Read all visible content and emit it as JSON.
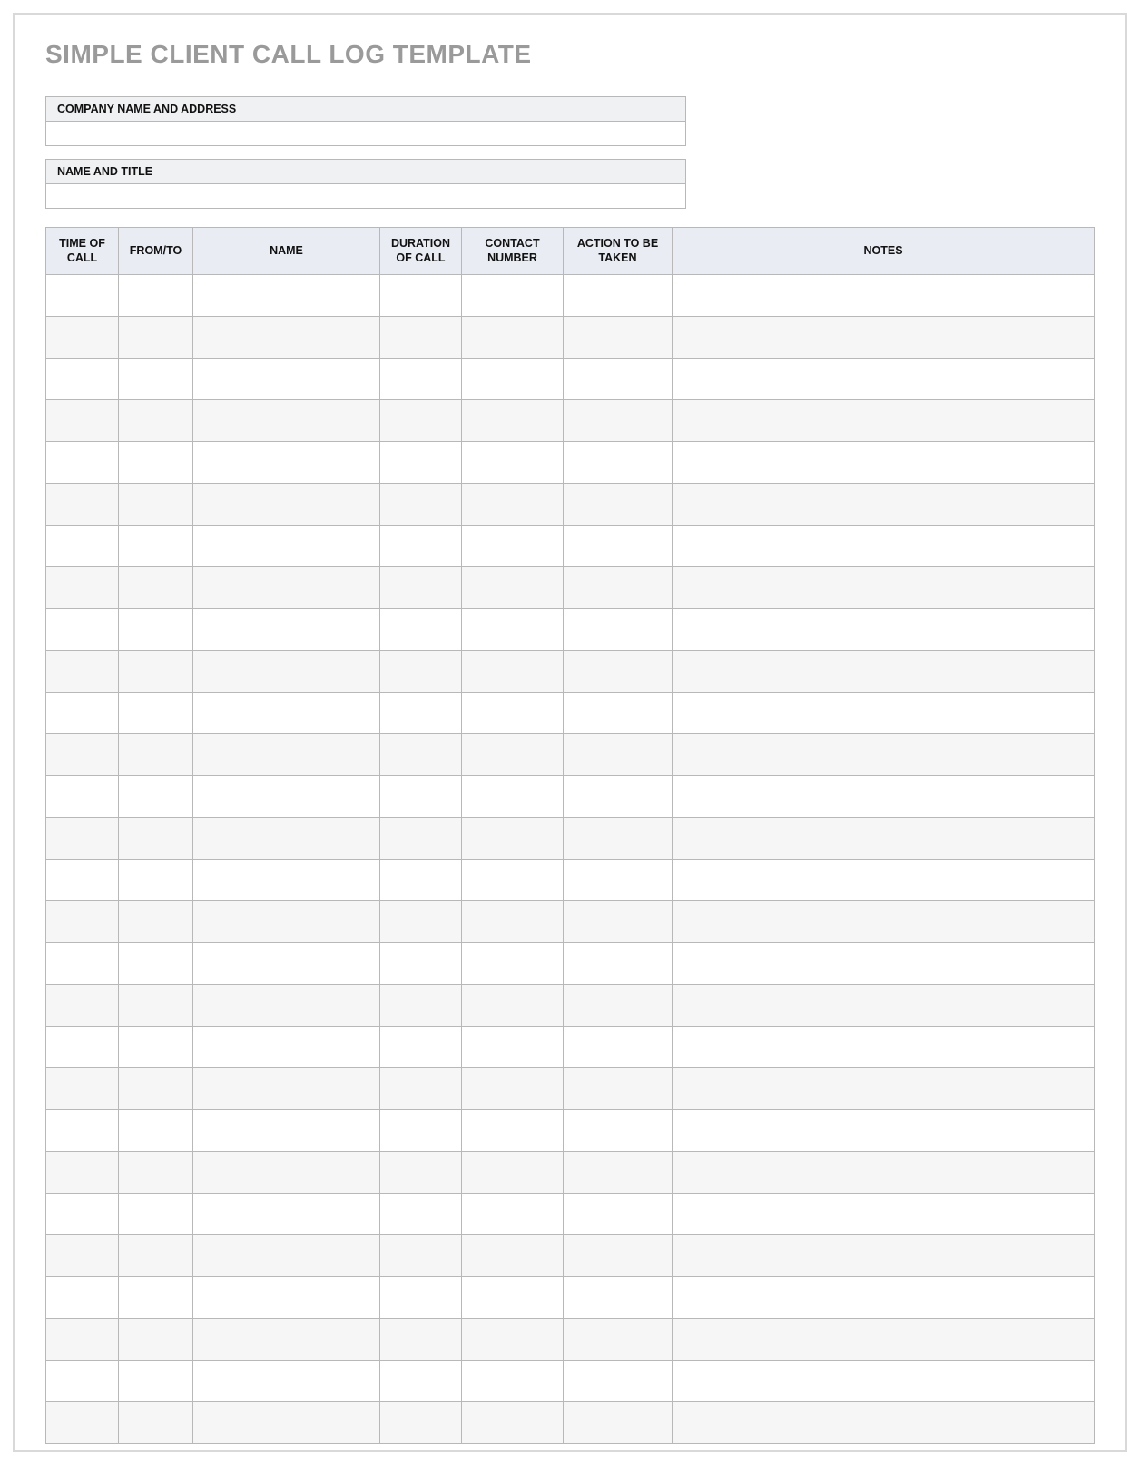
{
  "title": "SIMPLE CLIENT CALL LOG TEMPLATE",
  "info": {
    "company_label": "COMPANY NAME AND ADDRESS",
    "company_value": "",
    "name_label": "NAME AND TITLE",
    "name_value": ""
  },
  "table": {
    "headers": {
      "time": "TIME OF CALL",
      "fromto": "FROM/TO",
      "name": "NAME",
      "duration": "DURATION OF CALL",
      "contact": "CONTACT NUMBER",
      "action": "ACTION TO BE TAKEN",
      "notes": "NOTES"
    },
    "row_count": 28,
    "rows": [
      {
        "time": "",
        "fromto": "",
        "name": "",
        "duration": "",
        "contact": "",
        "action": "",
        "notes": ""
      },
      {
        "time": "",
        "fromto": "",
        "name": "",
        "duration": "",
        "contact": "",
        "action": "",
        "notes": ""
      },
      {
        "time": "",
        "fromto": "",
        "name": "",
        "duration": "",
        "contact": "",
        "action": "",
        "notes": ""
      },
      {
        "time": "",
        "fromto": "",
        "name": "",
        "duration": "",
        "contact": "",
        "action": "",
        "notes": ""
      },
      {
        "time": "",
        "fromto": "",
        "name": "",
        "duration": "",
        "contact": "",
        "action": "",
        "notes": ""
      },
      {
        "time": "",
        "fromto": "",
        "name": "",
        "duration": "",
        "contact": "",
        "action": "",
        "notes": ""
      },
      {
        "time": "",
        "fromto": "",
        "name": "",
        "duration": "",
        "contact": "",
        "action": "",
        "notes": ""
      },
      {
        "time": "",
        "fromto": "",
        "name": "",
        "duration": "",
        "contact": "",
        "action": "",
        "notes": ""
      },
      {
        "time": "",
        "fromto": "",
        "name": "",
        "duration": "",
        "contact": "",
        "action": "",
        "notes": ""
      },
      {
        "time": "",
        "fromto": "",
        "name": "",
        "duration": "",
        "contact": "",
        "action": "",
        "notes": ""
      },
      {
        "time": "",
        "fromto": "",
        "name": "",
        "duration": "",
        "contact": "",
        "action": "",
        "notes": ""
      },
      {
        "time": "",
        "fromto": "",
        "name": "",
        "duration": "",
        "contact": "",
        "action": "",
        "notes": ""
      },
      {
        "time": "",
        "fromto": "",
        "name": "",
        "duration": "",
        "contact": "",
        "action": "",
        "notes": ""
      },
      {
        "time": "",
        "fromto": "",
        "name": "",
        "duration": "",
        "contact": "",
        "action": "",
        "notes": ""
      },
      {
        "time": "",
        "fromto": "",
        "name": "",
        "duration": "",
        "contact": "",
        "action": "",
        "notes": ""
      },
      {
        "time": "",
        "fromto": "",
        "name": "",
        "duration": "",
        "contact": "",
        "action": "",
        "notes": ""
      },
      {
        "time": "",
        "fromto": "",
        "name": "",
        "duration": "",
        "contact": "",
        "action": "",
        "notes": ""
      },
      {
        "time": "",
        "fromto": "",
        "name": "",
        "duration": "",
        "contact": "",
        "action": "",
        "notes": ""
      },
      {
        "time": "",
        "fromto": "",
        "name": "",
        "duration": "",
        "contact": "",
        "action": "",
        "notes": ""
      },
      {
        "time": "",
        "fromto": "",
        "name": "",
        "duration": "",
        "contact": "",
        "action": "",
        "notes": ""
      },
      {
        "time": "",
        "fromto": "",
        "name": "",
        "duration": "",
        "contact": "",
        "action": "",
        "notes": ""
      },
      {
        "time": "",
        "fromto": "",
        "name": "",
        "duration": "",
        "contact": "",
        "action": "",
        "notes": ""
      },
      {
        "time": "",
        "fromto": "",
        "name": "",
        "duration": "",
        "contact": "",
        "action": "",
        "notes": ""
      },
      {
        "time": "",
        "fromto": "",
        "name": "",
        "duration": "",
        "contact": "",
        "action": "",
        "notes": ""
      },
      {
        "time": "",
        "fromto": "",
        "name": "",
        "duration": "",
        "contact": "",
        "action": "",
        "notes": ""
      },
      {
        "time": "",
        "fromto": "",
        "name": "",
        "duration": "",
        "contact": "",
        "action": "",
        "notes": ""
      },
      {
        "time": "",
        "fromto": "",
        "name": "",
        "duration": "",
        "contact": "",
        "action": "",
        "notes": ""
      },
      {
        "time": "",
        "fromto": "",
        "name": "",
        "duration": "",
        "contact": "",
        "action": "",
        "notes": ""
      }
    ]
  }
}
